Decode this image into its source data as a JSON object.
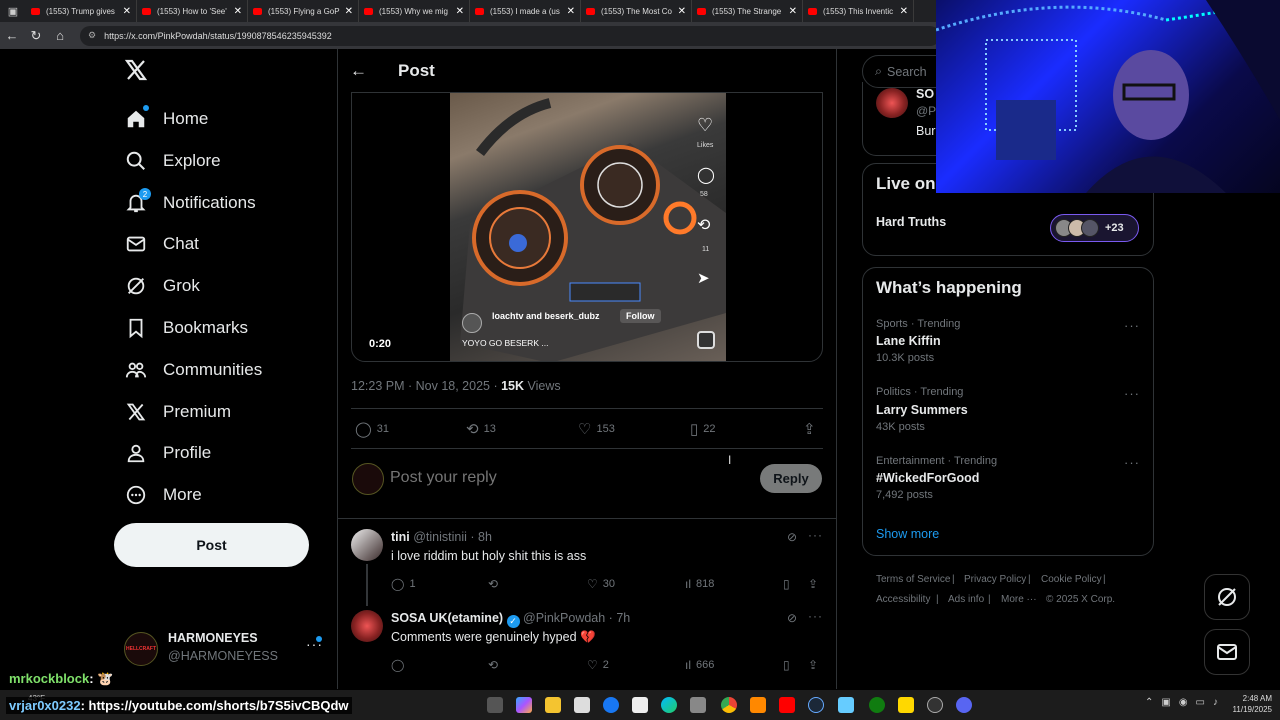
{
  "browser": {
    "tabs": [
      "(1553) Trump gives",
      "(1553) How to 'See'",
      "(1553) Flying a GoP",
      "(1553) Why we mig",
      "(1553) I made a (us",
      "(1553) The Most Co",
      "(1553) The Strange",
      "(1553) This Inventic"
    ],
    "url": "https://x.com/PinkPowdah/status/1990878546235945392"
  },
  "sidebar": {
    "items": [
      {
        "label": "Home",
        "icon": "home-icon"
      },
      {
        "label": "Explore",
        "icon": "search-icon"
      },
      {
        "label": "Notifications",
        "icon": "bell-icon",
        "badge": "2"
      },
      {
        "label": "Chat",
        "icon": "mail-icon"
      },
      {
        "label": "Grok",
        "icon": "grok-icon"
      },
      {
        "label": "Bookmarks",
        "icon": "bookmark-icon"
      },
      {
        "label": "Communities",
        "icon": "people-icon"
      },
      {
        "label": "Premium",
        "icon": "x-logo-icon"
      },
      {
        "label": "Profile",
        "icon": "person-icon"
      },
      {
        "label": "More",
        "icon": "more-circle-icon"
      }
    ],
    "post_label": "Post",
    "account": {
      "name": "HARMONEYES",
      "handle": "@HARMONEYESS",
      "avatar_text": "HELLCRAFT"
    }
  },
  "post": {
    "header_title": "Post",
    "video": {
      "duration": "0:20",
      "likes_label": "Likes",
      "comments_count": "58",
      "reposts_count": "11",
      "overlay_user": "loachtv and beserk_dubz",
      "follow_label": "Follow",
      "caption": "YOYO GO BESERK ..."
    },
    "timestamp": "12:23 PM · Nov 18, 2025 · ",
    "views_count": "15K",
    "views_label": " Views",
    "stats": {
      "replies": "31",
      "reposts": "13",
      "likes": "153",
      "bookmarks": "22"
    },
    "reply_placeholder": "Post your reply",
    "reply_button": "Reply"
  },
  "replies": [
    {
      "name": "tini",
      "handle": "@tinistinii · 8h",
      "text": "i love riddim but holy shit this is ass",
      "replies": "1",
      "reposts": "",
      "likes": "30",
      "views": "818"
    },
    {
      "name": "SOSA UK(etamine)",
      "handle": "@PinkPowdah · 7h",
      "text": "Comments were genuinely hyped 💔",
      "replies": "",
      "reposts": "",
      "likes": "2",
      "views": "666"
    }
  ],
  "right": {
    "search_placeholder": "Search",
    "top_card": {
      "name": "SO",
      "handle": "@P",
      "text": "Bur"
    },
    "live_title": "Live on",
    "live_item": "Hard Truths",
    "live_count": "+23",
    "happening_title": "What’s happening",
    "trends": [
      {
        "category": "Sports · Trending",
        "name": "Lane Kiffin",
        "count": "10.3K posts"
      },
      {
        "category": "Politics · Trending",
        "name": "Larry Summers",
        "count": "43K posts"
      },
      {
        "category": "Entertainment · Trending",
        "name": "#WickedForGood",
        "count": "7,492 posts"
      }
    ],
    "show_more": "Show more",
    "footer": [
      "Terms of Service",
      "|",
      "Privacy Policy",
      "|",
      "Cookie Policy",
      "|",
      "Accessibility",
      "|",
      "Ads info",
      "|",
      "More ···",
      "© 2025 X Corp."
    ]
  },
  "chat_overlay": [
    {
      "user": "mrkockblock",
      "text": ": 🐮"
    },
    {
      "user": "vrjar0x0232",
      "text": ": https://youtube.com/shorts/b7S5ivCBQdw"
    }
  ],
  "taskbar": {
    "time": "2:48 AM",
    "date": "11/19/2025",
    "weather": "43°F"
  },
  "colors": {
    "accent": "#1d9bf0",
    "background": "#000000",
    "muted": "#71767b",
    "webcam_blue": "#1a2cff"
  }
}
